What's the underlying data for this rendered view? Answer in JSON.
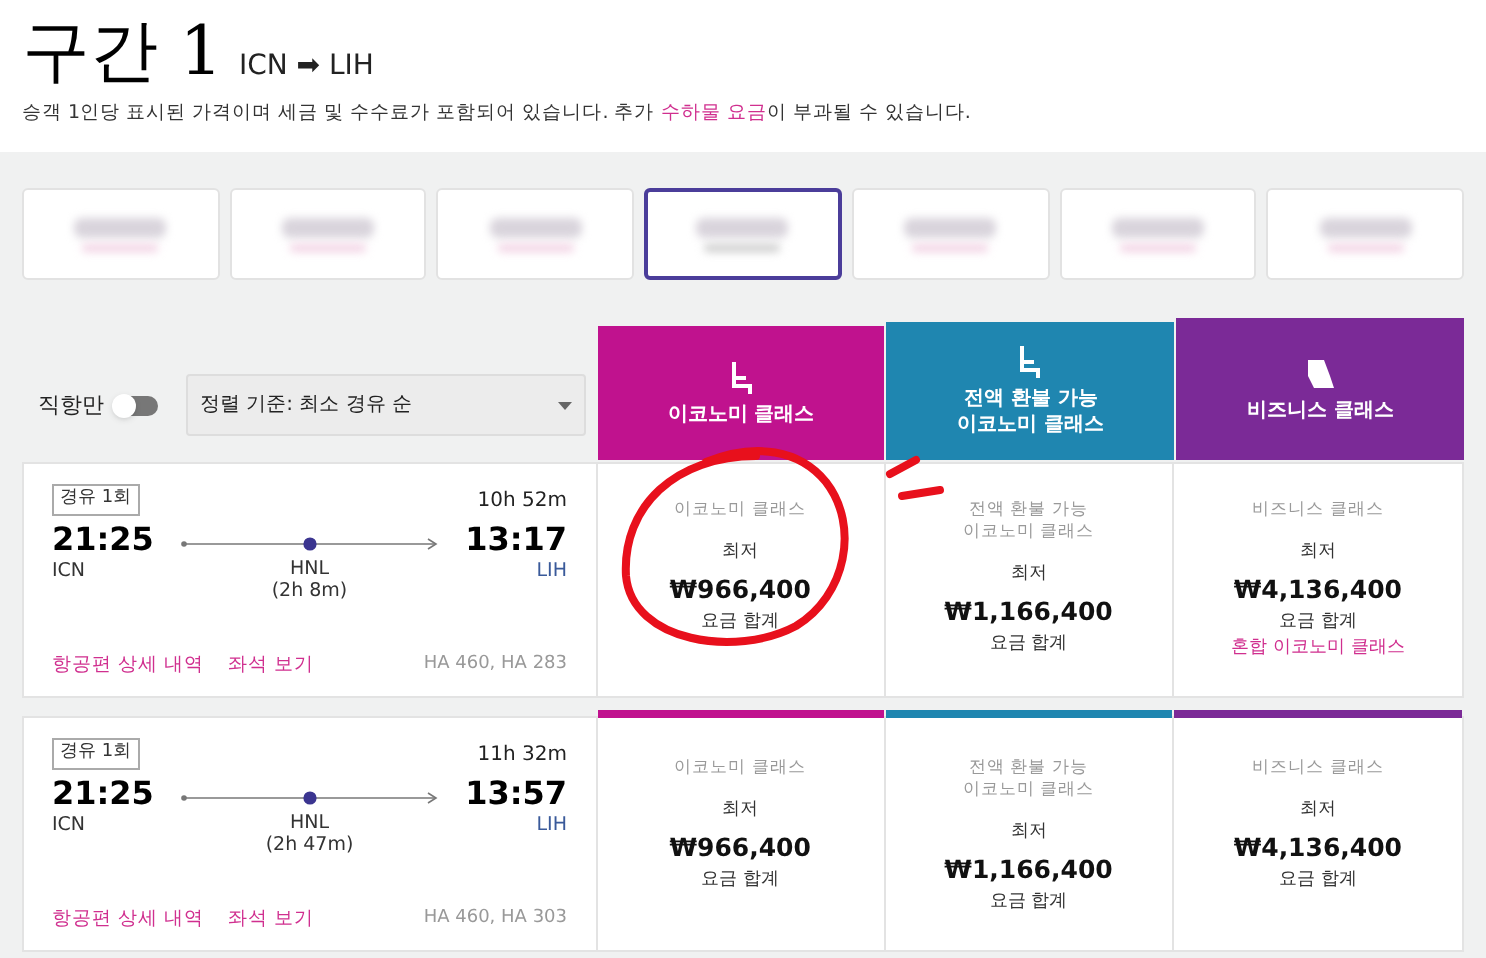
{
  "header": {
    "title": "구간 1",
    "route_from": "ICN",
    "route_arrow": "➡",
    "route_to": "LIH",
    "notice_before": "승객 1인당 표시된 가격이며 세금 및 수수료가 포함되어 있습니다. 추가 ",
    "notice_link": "수하물 요금",
    "notice_after": "이 부과될 수 있습니다."
  },
  "date_tabs": [
    {
      "selected": false
    },
    {
      "selected": false
    },
    {
      "selected": false
    },
    {
      "selected": true
    },
    {
      "selected": false
    },
    {
      "selected": false
    },
    {
      "selected": false
    }
  ],
  "filters": {
    "direct_label": "직항만",
    "direct_on": false,
    "sort_label": "정렬 기준: 최소 경유 순"
  },
  "fare_classes": [
    {
      "kind": "economy",
      "lines": [
        "이코노미 클래스"
      ],
      "color": "#c0128e"
    },
    {
      "kind": "economy",
      "lines": [
        "전액 환불 가능",
        "이코노미 클래스"
      ],
      "color": "#1f86b0"
    },
    {
      "kind": "business",
      "lines": [
        "비즈니스 클래스"
      ],
      "color": "#7b2a97"
    }
  ],
  "flights": [
    {
      "stops": "경유 1회",
      "duration": "10h 52m",
      "depart": "21:25",
      "from": "ICN",
      "via": "HNL",
      "layover": "(2h 8m)",
      "arrive": "13:17",
      "to": "LIH",
      "details_link": "항공편 상세 내역",
      "seats_link": "좌석 보기",
      "flight_numbers": "HA 460, HA 283",
      "class_bar": false,
      "fares": [
        {
          "lines": [
            "이코노미 클래스"
          ],
          "label": "최저",
          "price": "₩966,400",
          "note": "요금 합계"
        },
        {
          "lines": [
            "전액 환불 가능",
            "이코노미 클래스"
          ],
          "label": "최저",
          "price": "₩1,166,400",
          "note": "요금 합계"
        },
        {
          "lines": [
            "비즈니스 클래스"
          ],
          "label": "최저",
          "price": "₩4,136,400",
          "note": "요금 합계",
          "extra": "혼합 이코노미 클래스"
        }
      ]
    },
    {
      "stops": "경유 1회",
      "duration": "11h 32m",
      "depart": "21:25",
      "from": "ICN",
      "via": "HNL",
      "layover": "(2h 47m)",
      "arrive": "13:57",
      "to": "LIH",
      "details_link": "항공편 상세 내역",
      "seats_link": "좌석 보기",
      "flight_numbers": "HA 460, HA 303",
      "class_bar": true,
      "fares": [
        {
          "lines": [
            "이코노미 클래스"
          ],
          "label": "최저",
          "price": "₩966,400",
          "note": "요금 합계"
        },
        {
          "lines": [
            "전액 환불 가능",
            "이코노미 클래스"
          ],
          "label": "최저",
          "price": "₩1,166,400",
          "note": "요금 합계"
        },
        {
          "lines": [
            "비즈니스 클래스"
          ],
          "label": "최저",
          "price": "₩4,136,400",
          "note": "요금 합계"
        }
      ]
    }
  ]
}
